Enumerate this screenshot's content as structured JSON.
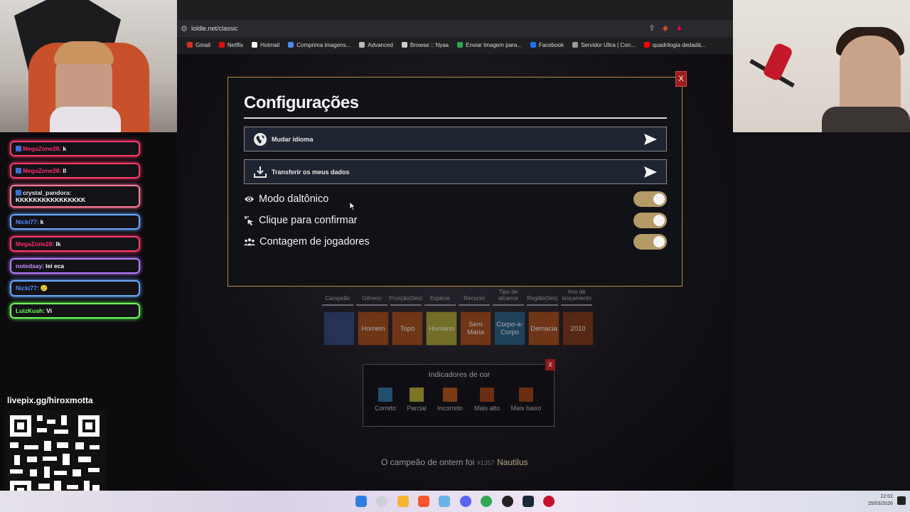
{
  "browser": {
    "url": "loldle.net/classic",
    "bookmarks": [
      {
        "label": "Gmail",
        "color": "#d93025"
      },
      {
        "label": "Netflix",
        "color": "#e50914"
      },
      {
        "label": "Hotmail",
        "color": "#ffffff"
      },
      {
        "label": "Comprima imagens...",
        "color": "#4a8cff"
      },
      {
        "label": "Advanced",
        "color": "#bbbbbb"
      },
      {
        "label": "Browse :: Nyaa",
        "color": "#cccccc"
      },
      {
        "label": "Enviar Imagem para...",
        "color": "#2fa84f"
      },
      {
        "label": "Facebook",
        "color": "#1877f2"
      },
      {
        "label": "Servidor Ultra | Con...",
        "color": "#999999"
      },
      {
        "label": "quadrilogia dedadá...",
        "color": "#ff0000"
      }
    ]
  },
  "chat": [
    {
      "user": "MegaZone28:",
      "text": "k",
      "user_color": "#ff2a6d",
      "border": "#ff3b6b",
      "icon": true
    },
    {
      "user": "MegaZone28:",
      "text": "ll",
      "user_color": "#ff2a6d",
      "border": "#ff3b6b",
      "icon": true
    },
    {
      "user": "crystal_pandora:",
      "text": "KKKKKKKKKKKKKKKK",
      "user_color": "#e9e9e9",
      "border": "#ff7a9a",
      "icon": true
    },
    {
      "user": "Nicki77:",
      "text": "k",
      "user_color": "#4f8dff",
      "border": "#6aa8ff",
      "icon": false
    },
    {
      "user": "MegaZone28:",
      "text": "lk",
      "user_color": "#ff2a6d",
      "border": "#ff3b6b",
      "icon": false
    },
    {
      "user": "notedaay:",
      "text": "lei eca",
      "user_color": "#c98bff",
      "border": "#b57bff",
      "icon": false
    },
    {
      "user": "Nicki77:",
      "text": "🥲",
      "user_color": "#4f8dff",
      "border": "#6aa8ff",
      "icon": false
    },
    {
      "user": "LuizKush:",
      "text": "Vi",
      "user_color": "#6dff5c",
      "border": "#6dff5c",
      "icon": false
    }
  ],
  "livepix": "livepix.gg/hiroxmotta",
  "game": {
    "headers": [
      "Campeão",
      "Gênero",
      "Posição(ões)",
      "Espécie",
      "Recurso",
      "Tipo de alcance",
      "Região(ões)",
      "Ano de lançamento"
    ],
    "tiles": [
      {
        "text": "",
        "color": "#2b3b6b"
      },
      {
        "text": "Homem",
        "color": "#8a3f14"
      },
      {
        "text": "Topo",
        "color": "#8a3f14"
      },
      {
        "text": "Humano",
        "color": "#8e8a2a"
      },
      {
        "text": "Sem Mana",
        "color": "#8a3f14"
      },
      {
        "text": "Corpo-a-Corpo",
        "color": "#1f4f6b"
      },
      {
        "text": "Demacia",
        "color": "#8a3f14"
      },
      {
        "text": "2010",
        "color": "#6b2e12"
      }
    ],
    "color_indicators": {
      "title": "Indicadores de cor",
      "close": "X",
      "items": [
        {
          "label": "Correto",
          "color": "#1f4f6b"
        },
        {
          "label": "Parcial",
          "color": "#7a7424"
        },
        {
          "label": "Incorreto",
          "color": "#7a3a12"
        },
        {
          "label": "Mais alto",
          "color": "#6b2e12"
        },
        {
          "label": "Mais baixo",
          "color": "#6b2e12"
        }
      ]
    },
    "yesterday": {
      "prefix": "O campeão de ontem foi",
      "number": "#1357",
      "champion": "Nautilus"
    }
  },
  "modal": {
    "title": "Configurações",
    "close": "X",
    "buttons": [
      {
        "label": "Mudar idioma",
        "icon": "globe-icon"
      },
      {
        "label": "Transferir os meus dados",
        "icon": "download-icon"
      }
    ],
    "toggles": [
      {
        "label": "Modo daltônico",
        "icon": "eye-icon",
        "on": true
      },
      {
        "label": "Clique para confirmar",
        "icon": "click-icon",
        "on": true
      },
      {
        "label": "Contagem de jogadores",
        "icon": "users-icon",
        "on": true
      }
    ]
  },
  "taskbar": {
    "time": "22:01",
    "date": "25/03/2026"
  }
}
